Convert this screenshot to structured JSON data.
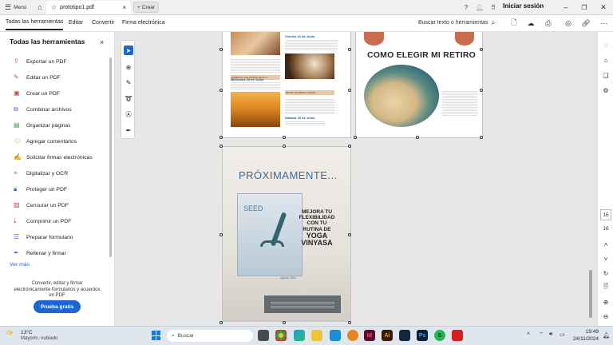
{
  "titlebar": {
    "menu_label": "Menú",
    "tab_title": "prototipo1.pdf",
    "new_tab_label": "Crear",
    "signin_label": "Iniciar sesión"
  },
  "menubar": {
    "items": [
      "Todas las herramientas",
      "Editar",
      "Convertir",
      "Firma electrónica"
    ],
    "search_placeholder": "Buscar texto o herramientas"
  },
  "panel": {
    "title": "Todas las herramientas",
    "tools": [
      {
        "label": "Exportar un PDF",
        "color": "#d8423c"
      },
      {
        "label": "Editar un PDF",
        "color": "#d8423c"
      },
      {
        "label": "Crear un PDF",
        "color": "#d8423c"
      },
      {
        "label": "Combinar archivos",
        "color": "#7b4fd0"
      },
      {
        "label": "Organizar páginas",
        "color": "#2c9d4e"
      },
      {
        "label": "Agregar comentarios",
        "color": "#e6a817"
      },
      {
        "label": "Solicitar firmas electrónicas",
        "color": "#7b4fd0"
      },
      {
        "label": "Digitalizar y OCR",
        "color": "#2c9d4e"
      },
      {
        "label": "Proteger un PDF",
        "color": "#3a5fcc"
      },
      {
        "label": "Censurar un PDF",
        "color": "#d8423c"
      },
      {
        "label": "Comprimir un PDF",
        "color": "#d8423c"
      },
      {
        "label": "Preparar formulario",
        "color": "#7b4fd0"
      },
      {
        "label": "Rellenar y firmar",
        "color": "#3a5fcc"
      }
    ],
    "see_more": "Ver más",
    "promo_text": "Convertir, editar y firmar electrónicamente formularios y acuerdos en PDF",
    "try_button": "Prueba gratis"
  },
  "pages": {
    "page1": {
      "heading_fri": "Viernes  21 de Junio",
      "heading_wed": "Miércoles 19 de Junio",
      "heading_sat": "Sábado 29 de Junio",
      "tag1": "BOMBEOS CON ÁLVARO SEVILLA",
      "tag2": "RETIRO   AL   MINDFULLNESS"
    },
    "page2": {
      "title": "COMO ELEGIR MI RETIRO"
    },
    "page3": {
      "headline": "PRÓXIMAMENTE...",
      "brand": "SEED",
      "tagline_lines": [
        "MEJORA TU",
        "FLEXIBILIDAD",
        "CON TU",
        "RUTINA DE",
        "YOGA",
        "VINYASA"
      ],
      "date": "Agosto 2024"
    }
  },
  "rightrail": {
    "page_current": "16",
    "page_total": "16"
  },
  "taskbar": {
    "weather_temp": "13°C",
    "weather_desc": "Mayorm. nublado",
    "search_placeholder": "Buscar",
    "time": "19:49",
    "date": "24/11/2024",
    "app_icons": [
      "Id",
      "Ai",
      "Ps",
      "S"
    ]
  }
}
